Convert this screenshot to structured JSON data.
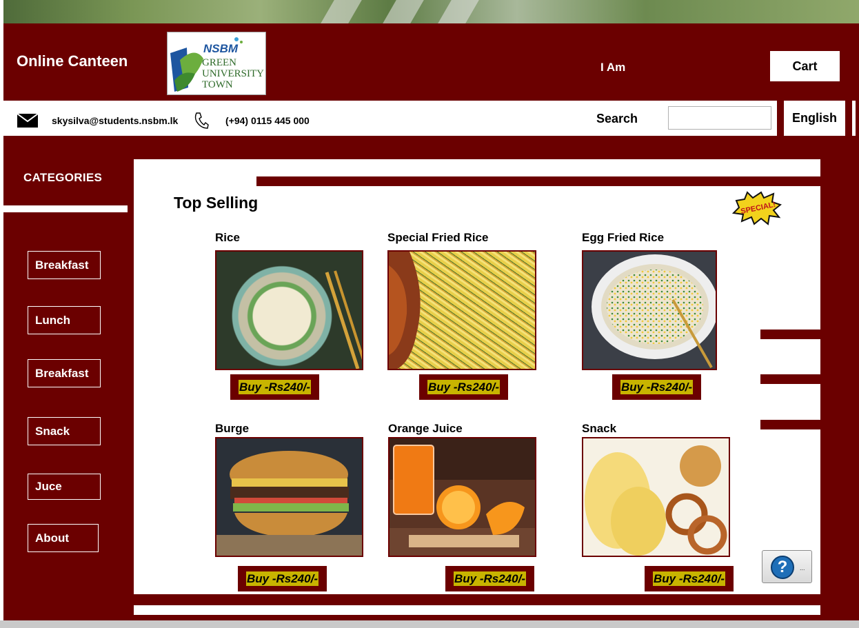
{
  "header": {
    "app_title": "Online Canteen",
    "logo_brand": "NSBM",
    "logo_lines": [
      "GREEN",
      "UNIVERSITY",
      "TOWN"
    ],
    "iam_label": "I Am",
    "cart_label": "Cart"
  },
  "contact": {
    "email": "skysilva@students.nsbm.lk",
    "phone": "(+94) 0115 445 000",
    "search_label": "Search",
    "search_value": "",
    "language_label": "English"
  },
  "sidebar": {
    "heading": "CATEGORIES",
    "items": [
      {
        "label": "Breakfast"
      },
      {
        "label": "Lunch"
      },
      {
        "label": "Breakfast"
      },
      {
        "label": "Snack"
      },
      {
        "label": "Juce"
      },
      {
        "label": "About"
      }
    ]
  },
  "main": {
    "section_title": "Top Selling",
    "special_badge": "SPECIAL!",
    "products": [
      {
        "name": "Rice",
        "buy_label": "Buy -Rs240/-",
        "image": "vegetable-rice-photo"
      },
      {
        "name": "Special Fried Rice",
        "buy_label": "Buy -Rs240/-",
        "image": "fried-rice-chicken-photo"
      },
      {
        "name": "Egg Fried Rice",
        "buy_label": "Buy -Rs240/-",
        "image": "egg-fried-rice-photo"
      },
      {
        "name": "Burge",
        "buy_label": "Buy -Rs240/-",
        "image": "burger-photo"
      },
      {
        "name": "Orange Juice",
        "buy_label": "Buy -Rs240/-",
        "image": "orange-juice-photo"
      },
      {
        "name": "Snack",
        "buy_label": "Buy -Rs240/-",
        "image": "chips-pretzels-photo"
      }
    ]
  },
  "help": {
    "symbol": "?",
    "dots": "..."
  },
  "colors": {
    "primary": "#6b0000",
    "buy_highlight": "#c8b400",
    "surface": "#ffffff"
  }
}
